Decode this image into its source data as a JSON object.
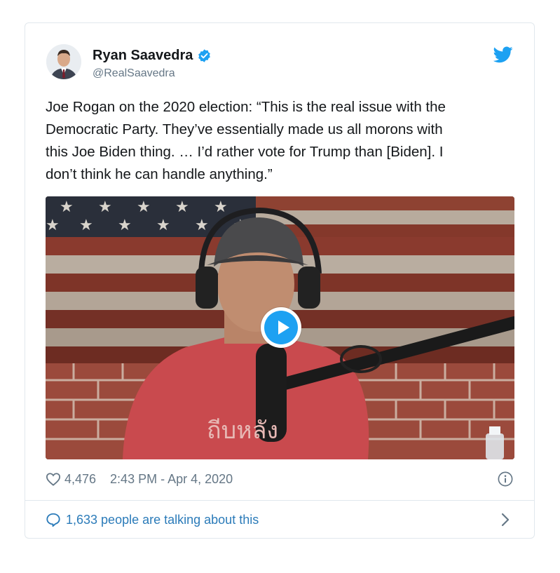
{
  "author": {
    "name": "Ryan Saavedra",
    "handle": "@RealSaavedra",
    "verified": true
  },
  "tweet": {
    "text": "Joe Rogan on the 2020 election: “This is the real issue with the\nDemocratic Party. They’ve essentially made us all morons with\nthis Joe Biden thing. … I’d rather vote for Trump than [Biden]. I\ndon’t think he can handle anything.”",
    "likes": "4,476",
    "timestamp": "2:43 PM - Apr 4, 2020"
  },
  "media": {
    "type": "video",
    "shirt_text": "ถีบหลัง"
  },
  "conversation": {
    "label": "1,633 people are talking about this"
  },
  "colors": {
    "accent": "#1da1f2",
    "link": "#2b7bb9",
    "muted": "#657786",
    "border": "#e1e8ed"
  },
  "icons": [
    "avatar",
    "verified-badge-icon",
    "twitter-bird-icon",
    "play-icon",
    "heart-icon",
    "info-icon",
    "speech-bubble-icon",
    "chevron-right-icon"
  ]
}
